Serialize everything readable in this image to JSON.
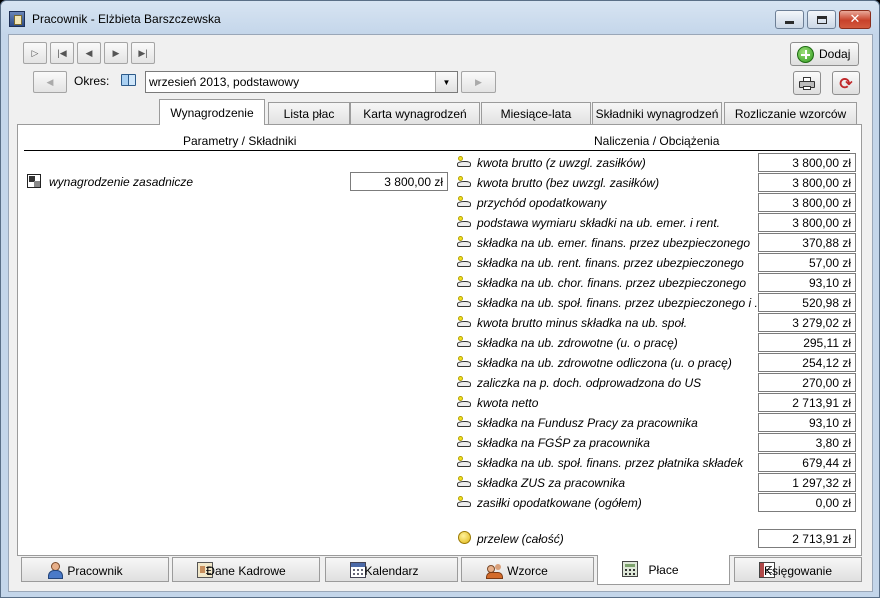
{
  "window": {
    "title": "Pracownik - Elżbieta Barszczewska"
  },
  "toolbar": {
    "add_label": "Dodaj",
    "period_label": "Okres:",
    "period_value": "wrzesień 2013, podstawowy"
  },
  "tabs": [
    {
      "label": "Wynagrodzenie",
      "active": true
    },
    {
      "label": "Lista płac"
    },
    {
      "label": "Karta wynagrodzeń"
    },
    {
      "label": "Miesiące-lata"
    },
    {
      "label": "Składniki wynagrodzeń"
    },
    {
      "label": "Rozliczanie wzorców"
    }
  ],
  "panel": {
    "left_header": "Parametry / Składniki",
    "right_header": "Naliczenia / Obciążenia",
    "components": [
      {
        "label": "wynagrodzenie zasadnicze",
        "value": "3 800,00 zł"
      }
    ],
    "calculations": [
      {
        "label": "kwota brutto (z uwzgl. zasiłków)",
        "value": "3 800,00 zł"
      },
      {
        "label": "kwota brutto (bez uwzgl. zasiłków)",
        "value": "3 800,00 zł"
      },
      {
        "label": "przychód opodatkowany",
        "value": "3 800,00 zł"
      },
      {
        "label": "podstawa wymiaru składki na ub. emer. i rent.",
        "value": "3 800,00 zł"
      },
      {
        "label": "składka na ub. emer. finans. przez ubezpieczonego",
        "value": "370,88 zł"
      },
      {
        "label": "składka na ub. rent. finans. przez ubezpieczonego",
        "value": "57,00 zł"
      },
      {
        "label": "składka na ub. chor. finans. przez ubezpieczonego",
        "value": "93,10 zł"
      },
      {
        "label": "składka na ub. społ. finans. przez ubezpieczonego i ...",
        "value": "520,98 zł"
      },
      {
        "label": "kwota brutto minus składka na ub. społ.",
        "value": "3 279,02 zł"
      },
      {
        "label": "składka na ub. zdrowotne (u. o pracę)",
        "value": "295,11 zł"
      },
      {
        "label": "składka na ub. zdrowotne odliczona (u. o pracę)",
        "value": "254,12 zł"
      },
      {
        "label": "zaliczka na p. doch. odprowadzona do US",
        "value": "270,00 zł"
      },
      {
        "label": "kwota netto",
        "value": "2 713,91 zł"
      },
      {
        "label": "składka na Fundusz Pracy za pracownika",
        "value": "93,10 zł"
      },
      {
        "label": "składka na FGŚP za pracownika",
        "value": "3,80 zł"
      },
      {
        "label": "składka na ub. społ. finans. przez płatnika składek",
        "value": "679,44 zł"
      },
      {
        "label": "składka ZUS za pracownika",
        "value": "1 297,32 zł"
      },
      {
        "label": "zasiłki opodatkowane (ogółem)",
        "value": "0,00 zł"
      }
    ],
    "transfer": {
      "label": "przelew (całość)",
      "value": "2 713,91 zł"
    }
  },
  "bottom_tabs": [
    {
      "label": "Pracownik",
      "icon": "person-icon"
    },
    {
      "label": "Dane Kadrowe",
      "icon": "id-card-icon"
    },
    {
      "label": "Kalendarz",
      "icon": "calendar-icon"
    },
    {
      "label": "Wzorce",
      "icon": "people-icon"
    },
    {
      "label": "Płace",
      "icon": "calculator-icon",
      "active": true
    },
    {
      "label": "Księgowanie",
      "icon": "ledger-icon"
    }
  ]
}
